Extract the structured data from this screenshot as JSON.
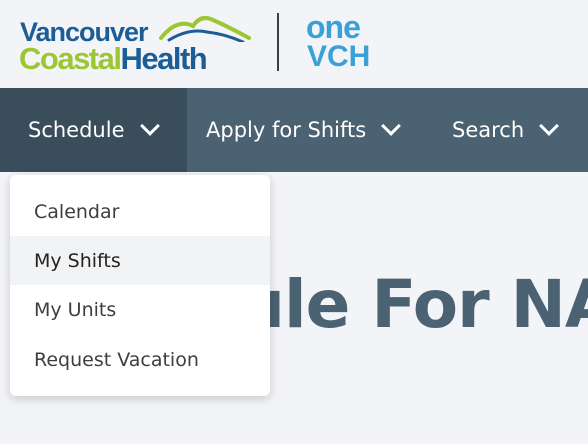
{
  "header": {
    "logo_line1": "Vancouver",
    "logo_line2_a": "Coastal",
    "logo_line2_b": "Health",
    "one_top": "one",
    "one_bottom": "VCH"
  },
  "nav": {
    "items": [
      {
        "label": "Schedule",
        "active": true
      },
      {
        "label": "Apply for Shifts",
        "active": false
      },
      {
        "label": "Search",
        "active": false
      }
    ]
  },
  "dropdown": {
    "items": [
      {
        "label": "Calendar"
      },
      {
        "label": "My Shifts",
        "hovered": true
      },
      {
        "label": "My Units"
      },
      {
        "label": "Request Vacation"
      }
    ]
  },
  "page": {
    "title_visible": "ule For NA"
  },
  "colors": {
    "nav_bg": "#4a6271",
    "nav_active_bg": "#3a4d5a",
    "page_bg": "#f3f4f8",
    "brand_blue": "#1c5d96",
    "brand_green": "#9cc632",
    "one_blue": "#3aa0d8"
  }
}
